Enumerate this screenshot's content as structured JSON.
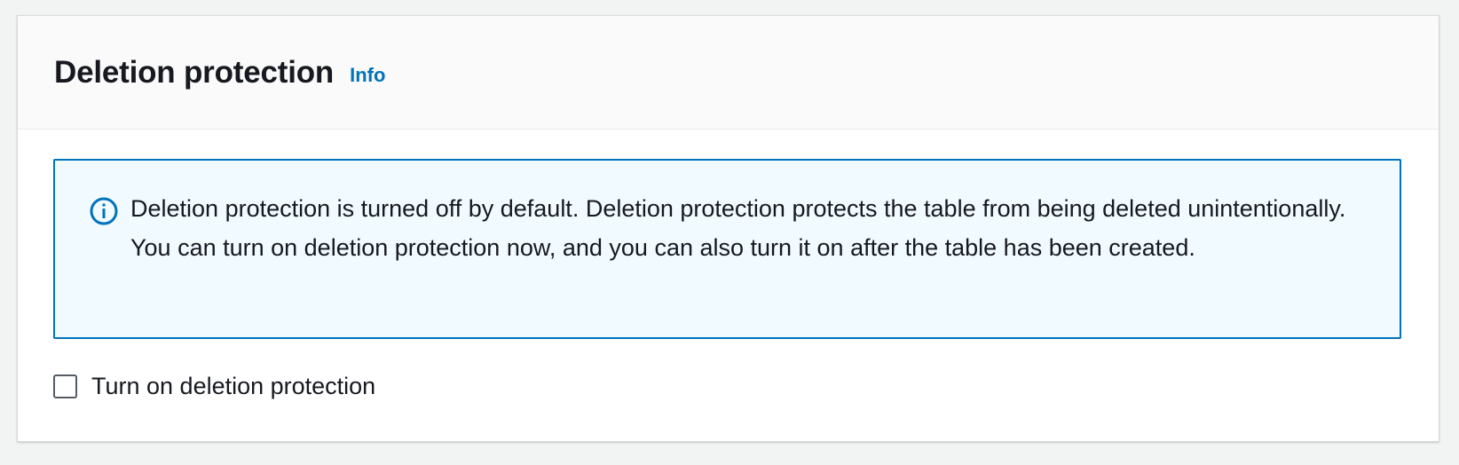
{
  "panel": {
    "title": "Deletion protection",
    "info_link": "Info"
  },
  "alert": {
    "icon": "info-circle-icon",
    "text": "Deletion protection is turned off by default. Deletion protection protects the table from being deleted unintentionally. You can turn on deletion protection now, and you can also turn it on after the table has been created.",
    "border_color": "#0073bb",
    "background_color": "#f1faff"
  },
  "checkbox": {
    "label": "Turn on deletion protection",
    "checked": false
  },
  "colors": {
    "link": "#0073bb",
    "text": "#16191f"
  }
}
